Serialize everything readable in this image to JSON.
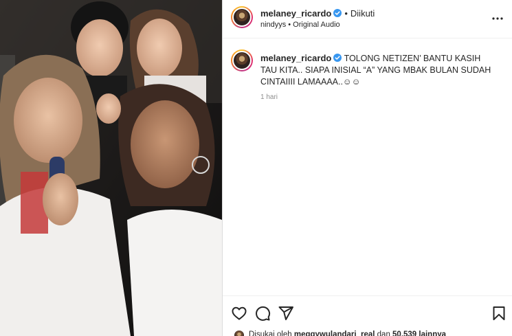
{
  "header": {
    "username": "melaney_ricardo",
    "separator": "•",
    "follow_status": "Diikuti",
    "audio_owner": "nindyys",
    "audio_separator": "•",
    "audio_label": "Original Audio"
  },
  "caption": {
    "username": "melaney_ricardo",
    "text": "TOLONG NETIZEN’ BANTU KASIH TAU KITA.. SIAPA INISIAL “A” YANG MBAK BULAN SUDAH CINTAIIII LAMAAAA..☺☺",
    "time": "1 hari"
  },
  "likes": {
    "prefix": "Disukai oleh ",
    "user": "meggywulandari_real",
    "middle": " dan ",
    "count": "50.539 lainnya"
  },
  "icons": {
    "verified": "verified-badge-icon",
    "more": "more-options-icon",
    "like": "heart-icon",
    "comment": "comment-icon",
    "share": "share-icon",
    "save": "bookmark-icon"
  },
  "colors": {
    "verified": "#3897f0",
    "text": "#262626",
    "muted": "#8e8e8e"
  }
}
